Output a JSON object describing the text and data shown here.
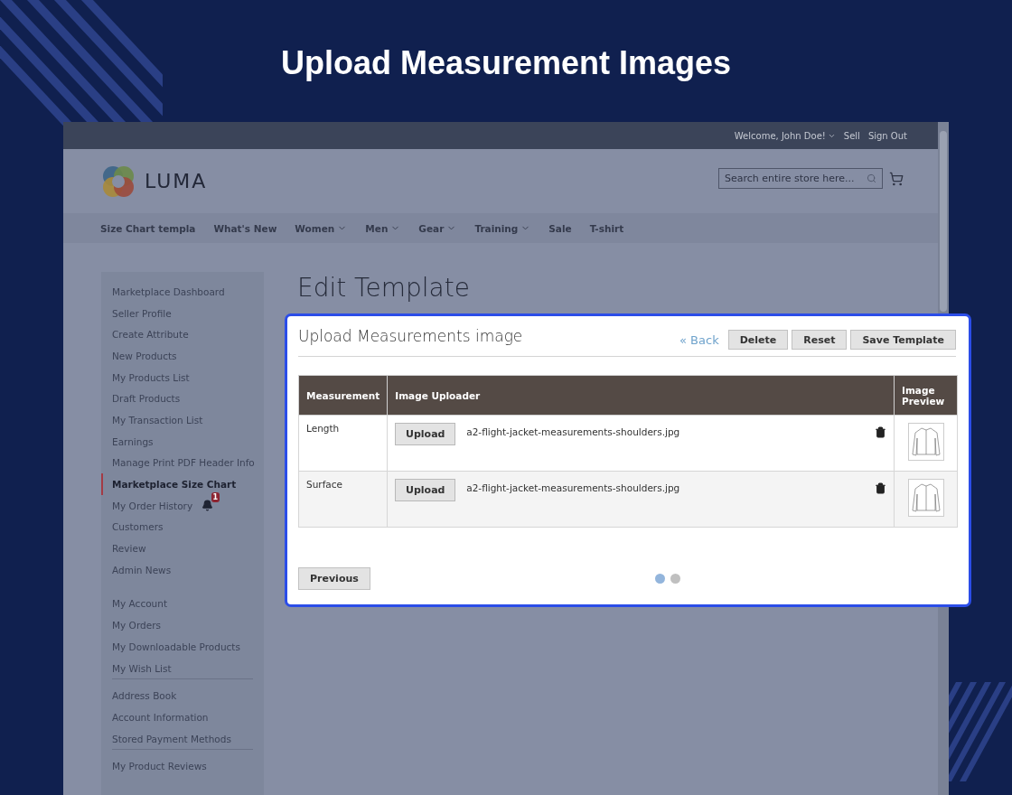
{
  "heading": "Upload Measurement Images",
  "top_bar": {
    "welcome": "Welcome, John Doe!",
    "links": [
      "Sell",
      "Sign Out"
    ]
  },
  "logo": {
    "text": "LUMA"
  },
  "search": {
    "placeholder": "Search entire store here..."
  },
  "nav": [
    {
      "label": "Size Chart templa",
      "has_menu": false
    },
    {
      "label": "What's New",
      "has_menu": false
    },
    {
      "label": "Women",
      "has_menu": true
    },
    {
      "label": "Men",
      "has_menu": true
    },
    {
      "label": "Gear",
      "has_menu": true
    },
    {
      "label": "Training",
      "has_menu": true
    },
    {
      "label": "Sale",
      "has_menu": false
    },
    {
      "label": "T-shirt",
      "has_menu": false
    }
  ],
  "sidebar": [
    {
      "divider_above": false,
      "items": [
        {
          "label": "Marketplace Dashboard",
          "selected": false
        },
        {
          "label": "Seller Profile",
          "selected": false
        },
        {
          "label": "Create Attribute",
          "selected": false
        },
        {
          "label": "New Products",
          "selected": false
        },
        {
          "label": "My Products List",
          "selected": false
        },
        {
          "label": "Draft Products",
          "selected": false
        },
        {
          "label": "My Transaction List",
          "selected": false
        },
        {
          "label": "Earnings",
          "selected": false
        },
        {
          "label": "Manage Print PDF Header Info",
          "selected": false
        },
        {
          "label": "Marketplace Size Chart",
          "selected": true
        },
        {
          "label": "My Order History",
          "selected": false,
          "badge": "1"
        },
        {
          "label": "Customers",
          "selected": false
        },
        {
          "label": "Review",
          "selected": false
        },
        {
          "label": "Admin News",
          "selected": false
        }
      ]
    },
    {
      "divider_above": false,
      "items": [
        {
          "label": "My Account",
          "selected": false
        },
        {
          "label": "My Orders",
          "selected": false
        },
        {
          "label": "My Downloadable Products",
          "selected": false
        },
        {
          "label": "My Wish List",
          "selected": false
        }
      ]
    },
    {
      "divider_above": true,
      "items": [
        {
          "label": "Address Book",
          "selected": false
        },
        {
          "label": "Account Information",
          "selected": false
        },
        {
          "label": "Stored Payment Methods",
          "selected": false
        }
      ]
    },
    {
      "divider_above": true,
      "items": [
        {
          "label": "My Product Reviews",
          "selected": false
        }
      ]
    }
  ],
  "page_title": "Edit Template",
  "modal": {
    "title": "Upload Measurements image",
    "back_link": "« Back",
    "buttons": [
      "Delete",
      "Reset",
      "Save Template"
    ],
    "table": {
      "columns": [
        "Measurement",
        "Image Uploader",
        "Image Preview"
      ],
      "rows": [
        {
          "measurement": "Length",
          "upload_button": "Upload",
          "file_name": "a2-flight-jacket-measurements-shoulders.jpg"
        },
        {
          "measurement": "Surface",
          "upload_button": "Upload",
          "file_name": "a2-flight-jacket-measurements-shoulders.jpg"
        }
      ]
    },
    "pages": [
      {
        "selected": true
      },
      {
        "selected": false
      }
    ],
    "previous_button": "Previous"
  }
}
